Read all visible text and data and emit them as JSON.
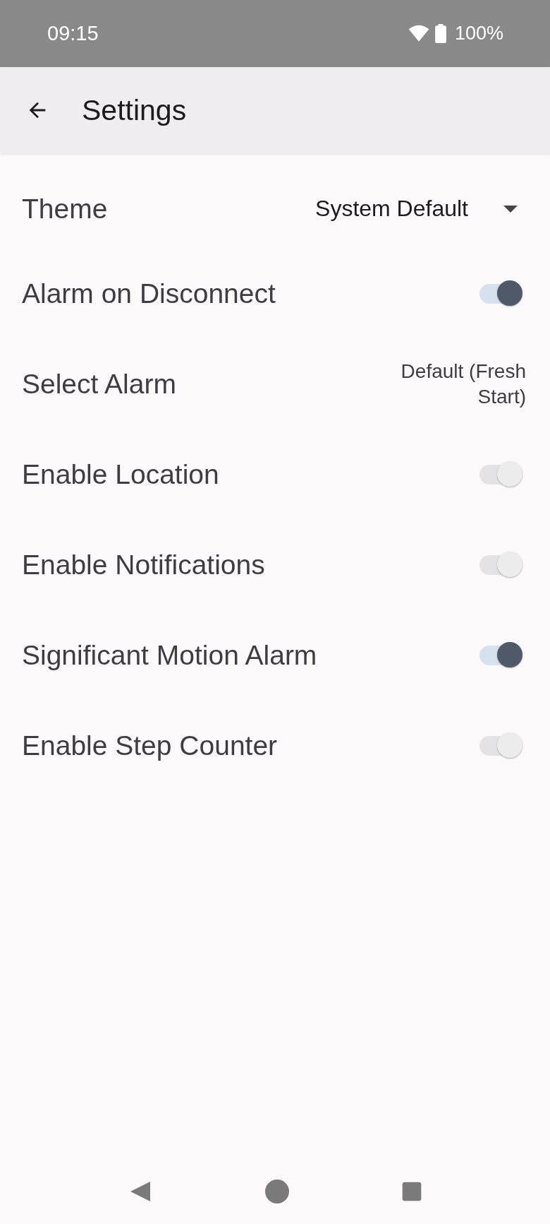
{
  "status_bar": {
    "time": "09:15",
    "battery": "100%"
  },
  "app_bar": {
    "title": "Settings"
  },
  "settings": [
    {
      "kind": "dropdown",
      "label": "Theme",
      "value": "System Default"
    },
    {
      "kind": "switch",
      "label": "Alarm on Disconnect",
      "on": true,
      "disabled": false
    },
    {
      "kind": "value",
      "label": "Select Alarm",
      "value": "Default (Fresh Start)"
    },
    {
      "kind": "switch",
      "label": "Enable Location",
      "on": true,
      "disabled": true
    },
    {
      "kind": "switch",
      "label": "Enable Notifications",
      "on": true,
      "disabled": true
    },
    {
      "kind": "switch",
      "label": "Significant Motion Alarm",
      "on": true,
      "disabled": false
    },
    {
      "kind": "switch",
      "label": "Enable Step Counter",
      "on": true,
      "disabled": true
    }
  ]
}
